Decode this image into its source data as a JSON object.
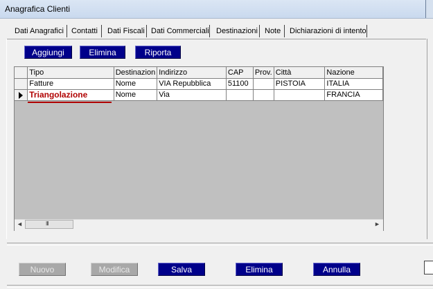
{
  "window": {
    "title": "Anagrafica Clienti"
  },
  "tabs": [
    {
      "label": "Dati Anagrafici"
    },
    {
      "label": "Contatti"
    },
    {
      "label": "Dati Fiscali"
    },
    {
      "label": "Dati Commerciali"
    },
    {
      "label": "Destinazioni",
      "active": true
    },
    {
      "label": "Note"
    },
    {
      "label": "Dichiarazioni di intento"
    }
  ],
  "toolbar": {
    "add_label": "Aggiungi",
    "delete_label": "Elimina",
    "copy_label": "Riporta"
  },
  "grid": {
    "columns": [
      "Tipo",
      "Destinazion",
      "Indirizzo",
      "CAP",
      "Prov.",
      "Città",
      "Nazione"
    ],
    "rows": [
      {
        "tipo": "Fatture",
        "destinazione": "Nome",
        "indirizzo": "VIA Repubblica",
        "cap": "51100",
        "prov": "",
        "citta": "PISTOIA",
        "nazione": "ITALIA"
      },
      {
        "tipo": "Triangolazione",
        "destinazione": "Nome",
        "indirizzo": "Via",
        "cap": "",
        "prov": "",
        "citta": "",
        "nazione": "FRANCIA"
      }
    ]
  },
  "scrollbar": {
    "left_arrow": "◄",
    "right_arrow": "►",
    "grip": "III"
  },
  "footer": {
    "new_label": "Nuovo",
    "edit_label": "Modifica",
    "save_label": "Salva",
    "delete_label": "Elimina",
    "cancel_label": "Annulla"
  },
  "colors": {
    "button_blue": "#00008a",
    "highlight_red": "#b00000",
    "grid_bg": "#c0c0c0"
  }
}
